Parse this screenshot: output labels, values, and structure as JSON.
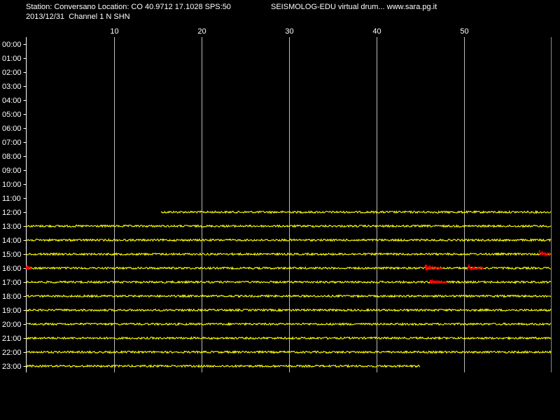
{
  "header": {
    "station_line": "Station: Conversano Location: CO 40.9712 17.1028 SPS:50",
    "app_line": "SEISMOLOG-EDU virtual drum... www.sara.pg.it",
    "date_line": "2013/12/31  Channel 1 N SHN"
  },
  "colors": {
    "background": "#000000",
    "trace": "#ffff00",
    "event": "#ff0000",
    "grid": "#ffffff"
  },
  "chart_data": {
    "type": "line",
    "title": "",
    "xlabel": "",
    "ylabel": "",
    "xlim": [
      0,
      60
    ],
    "x_ticks": [
      10,
      20,
      30,
      40,
      50
    ],
    "hours": [
      "00:00",
      "01:00",
      "02:00",
      "03:00",
      "04:00",
      "05:00",
      "06:00",
      "07:00",
      "08:00",
      "09:00",
      "10:00",
      "11:00",
      "12:00",
      "13:00",
      "14:00",
      "15:00",
      "16:00",
      "17:00",
      "18:00",
      "19:00",
      "20:00",
      "21:00",
      "22:00",
      "23:00"
    ],
    "traces": [
      {
        "hour": "12:00",
        "start_min": 15.4,
        "end_min": 60
      },
      {
        "hour": "13:00",
        "start_min": 0,
        "end_min": 60
      },
      {
        "hour": "14:00",
        "start_min": 0,
        "end_min": 60
      },
      {
        "hour": "15:00",
        "start_min": 0,
        "end_min": 60
      },
      {
        "hour": "16:00",
        "start_min": 0,
        "end_min": 60
      },
      {
        "hour": "17:00",
        "start_min": 0,
        "end_min": 60
      },
      {
        "hour": "18:00",
        "start_min": 0,
        "end_min": 60
      },
      {
        "hour": "19:00",
        "start_min": 0,
        "end_min": 60
      },
      {
        "hour": "20:00",
        "start_min": 0,
        "end_min": 60
      },
      {
        "hour": "21:00",
        "start_min": 0,
        "end_min": 60
      },
      {
        "hour": "22:00",
        "start_min": 0,
        "end_min": 60
      },
      {
        "hour": "23:00",
        "start_min": 0,
        "end_min": 45
      }
    ],
    "events": [
      {
        "hour": "15:00",
        "start_min": 58.6,
        "end_min": 60
      },
      {
        "hour": "16:00",
        "start_min": 0,
        "end_min": 0.6
      },
      {
        "hour": "16:00",
        "start_min": 45.5,
        "end_min": 47.6
      },
      {
        "hour": "16:00",
        "start_min": 50.4,
        "end_min": 52.3
      },
      {
        "hour": "17:00",
        "start_min": 46.1,
        "end_min": 48.2
      }
    ],
    "grid": true
  }
}
